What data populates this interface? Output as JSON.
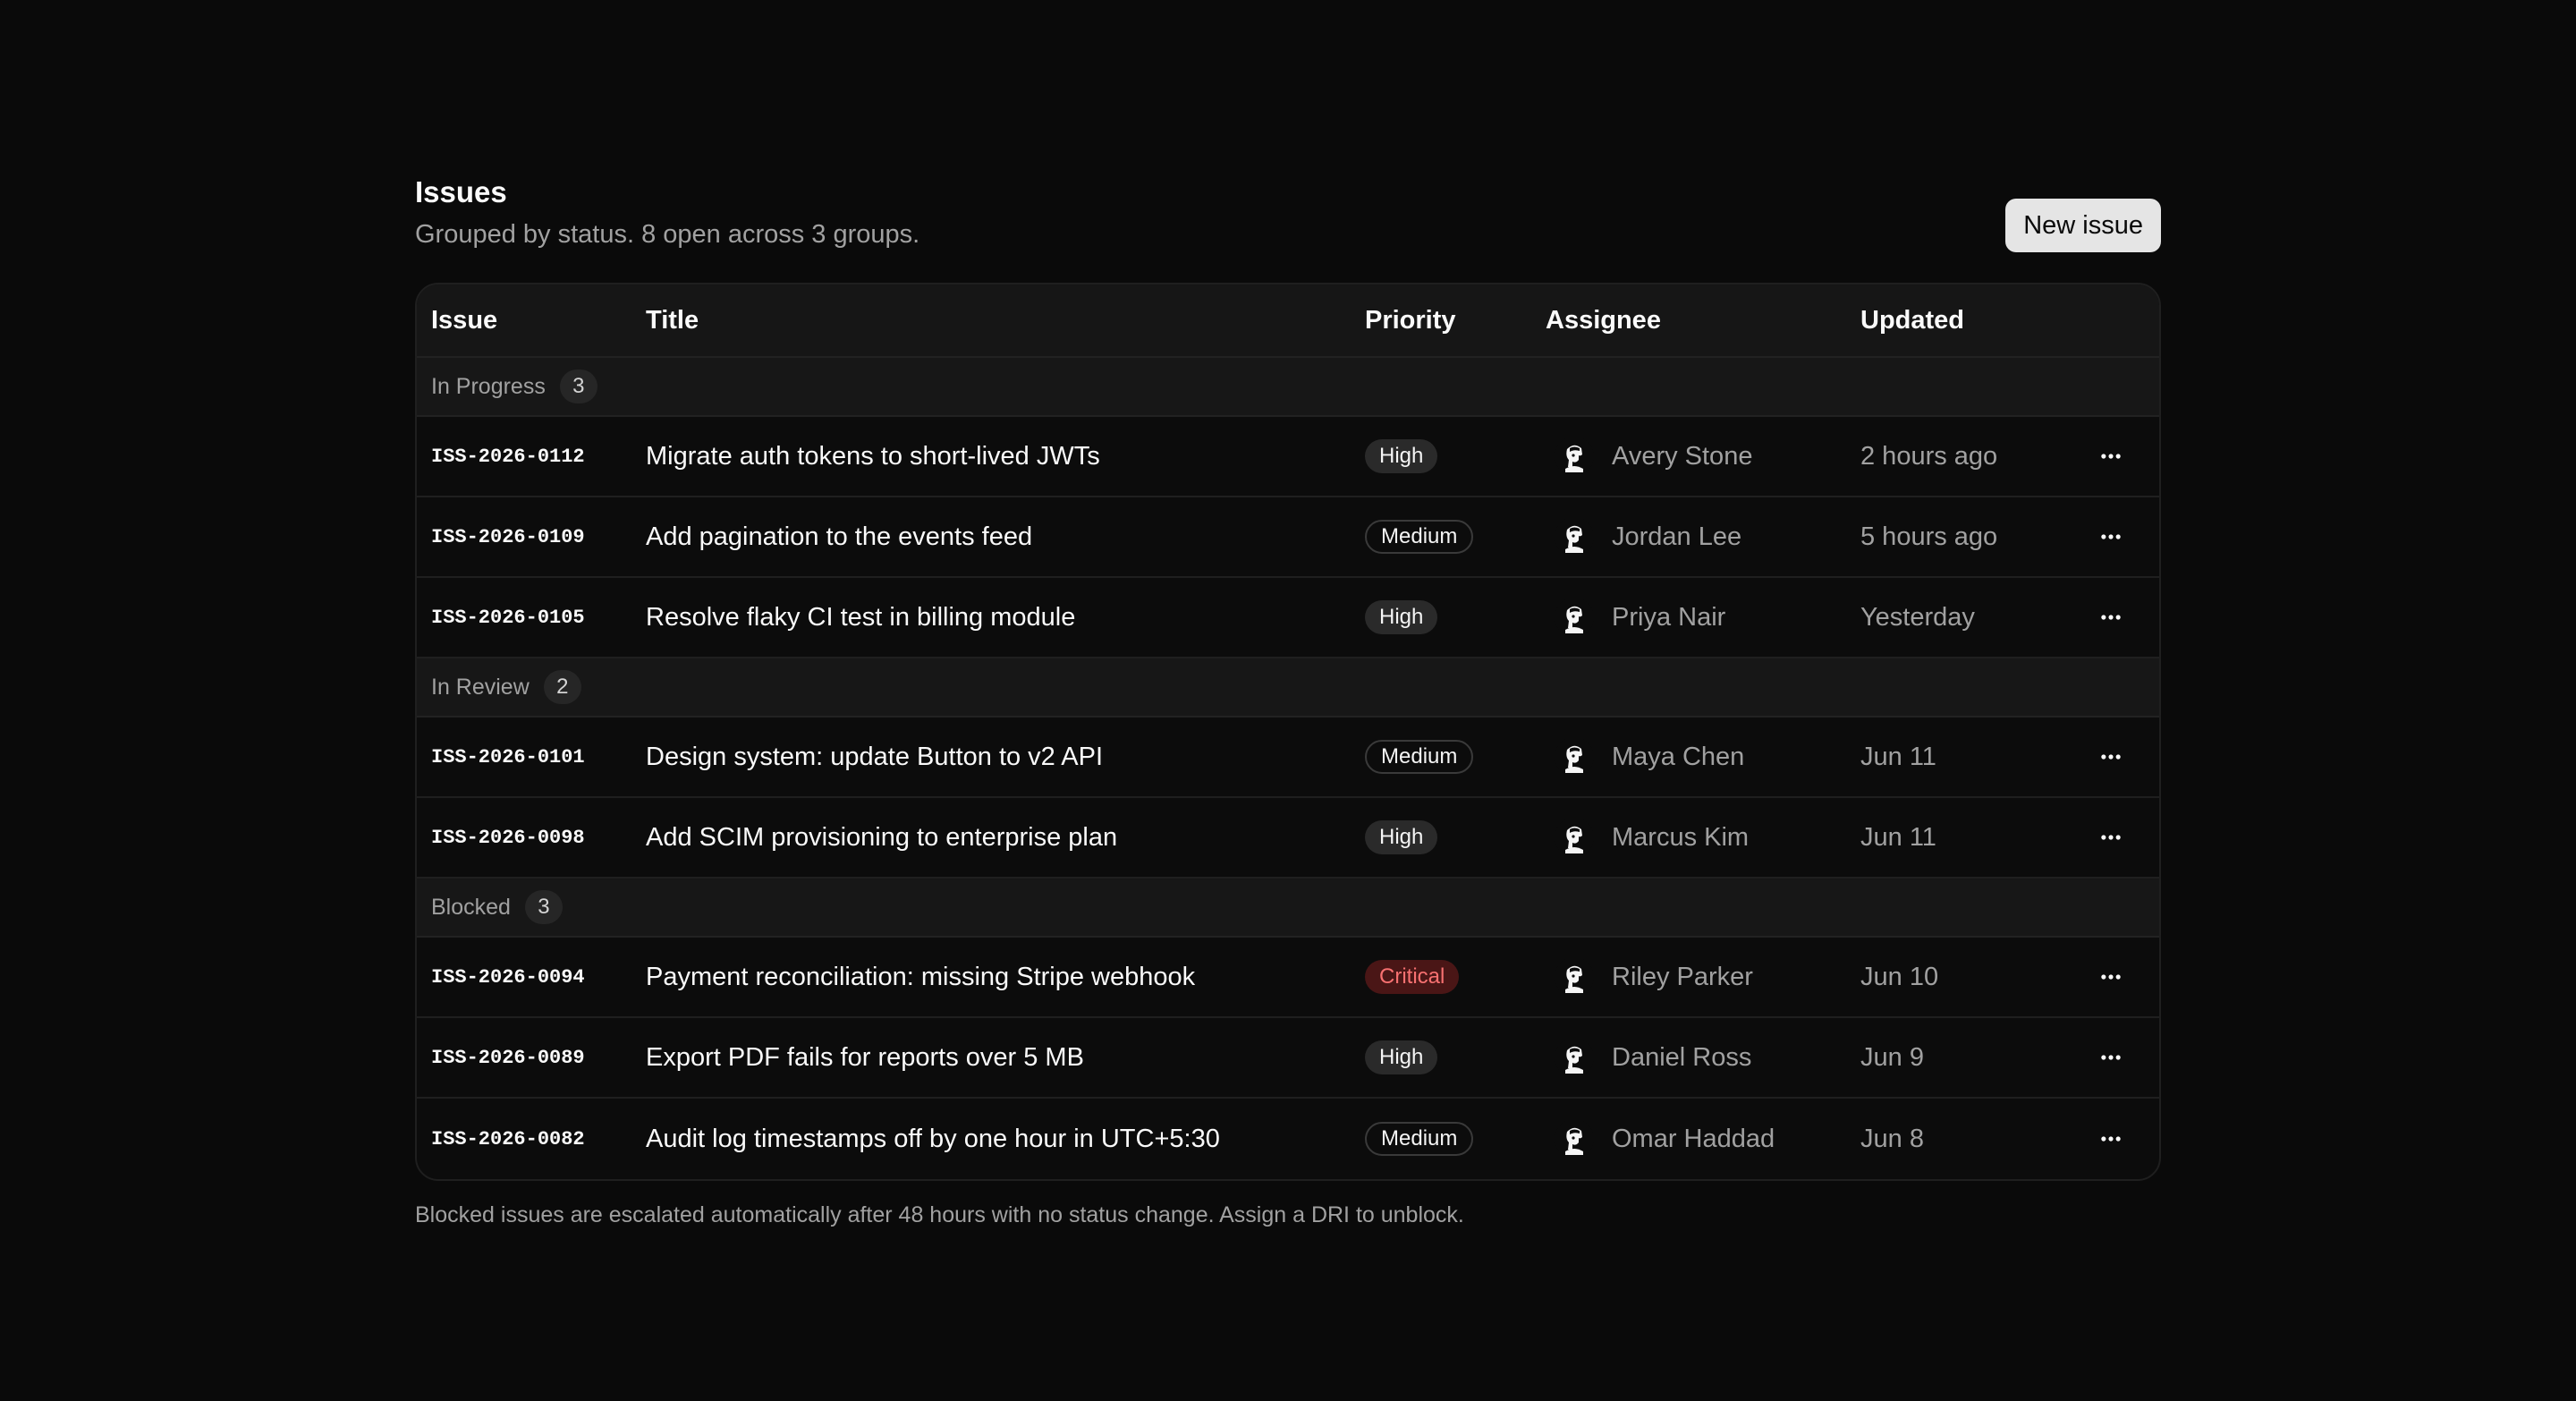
{
  "header": {
    "title": "Issues",
    "subtitle": "Grouped by status. 8 open across 3 groups.",
    "new_issue_label": "New issue"
  },
  "columns": {
    "issue": "Issue",
    "title": "Title",
    "priority": "Priority",
    "assignee": "Assignee",
    "updated": "Updated"
  },
  "groups": [
    {
      "name": "In Progress",
      "count": "3",
      "rows": [
        {
          "id": "ISS-2026-0112",
          "title": "Migrate auth tokens to short-lived JWTs",
          "priority": "High",
          "assignee": "Avery Stone",
          "updated": "2 hours ago"
        },
        {
          "id": "ISS-2026-0109",
          "title": "Add pagination to the events feed",
          "priority": "Medium",
          "assignee": "Jordan Lee",
          "updated": "5 hours ago"
        },
        {
          "id": "ISS-2026-0105",
          "title": "Resolve flaky CI test in billing module",
          "priority": "High",
          "assignee": "Priya Nair",
          "updated": "Yesterday"
        }
      ]
    },
    {
      "name": "In Review",
      "count": "2",
      "rows": [
        {
          "id": "ISS-2026-0101",
          "title": "Design system: update Button to v2 API",
          "priority": "Medium",
          "assignee": "Maya Chen",
          "updated": "Jun 11"
        },
        {
          "id": "ISS-2026-0098",
          "title": "Add SCIM provisioning to enterprise plan",
          "priority": "High",
          "assignee": "Marcus Kim",
          "updated": "Jun 11"
        }
      ]
    },
    {
      "name": "Blocked",
      "count": "3",
      "rows": [
        {
          "id": "ISS-2026-0094",
          "title": "Payment reconciliation: missing Stripe webhook",
          "priority": "Critical",
          "assignee": "Riley Parker",
          "updated": "Jun 10"
        },
        {
          "id": "ISS-2026-0089",
          "title": "Export PDF fails for reports over 5 MB",
          "priority": "High",
          "assignee": "Daniel Ross",
          "updated": "Jun 9"
        },
        {
          "id": "ISS-2026-0082",
          "title": "Audit log timestamps off by one hour in UTC+5:30",
          "priority": "Medium",
          "assignee": "Omar Haddad",
          "updated": "Jun 8"
        }
      ]
    }
  ],
  "footnote": "Blocked issues are escalated automatically after 48 hours with no status change. Assign a DRI to unblock.",
  "icons": {
    "row_actions": "more-horizontal-icon",
    "avatar": "avatar-illustration"
  },
  "colors": {
    "background": "#0a0a0a",
    "critical": "#f87171",
    "critical_bg": "#4a1616",
    "muted_text": "#a1a1a1",
    "button_bg": "#e5e5e5"
  }
}
